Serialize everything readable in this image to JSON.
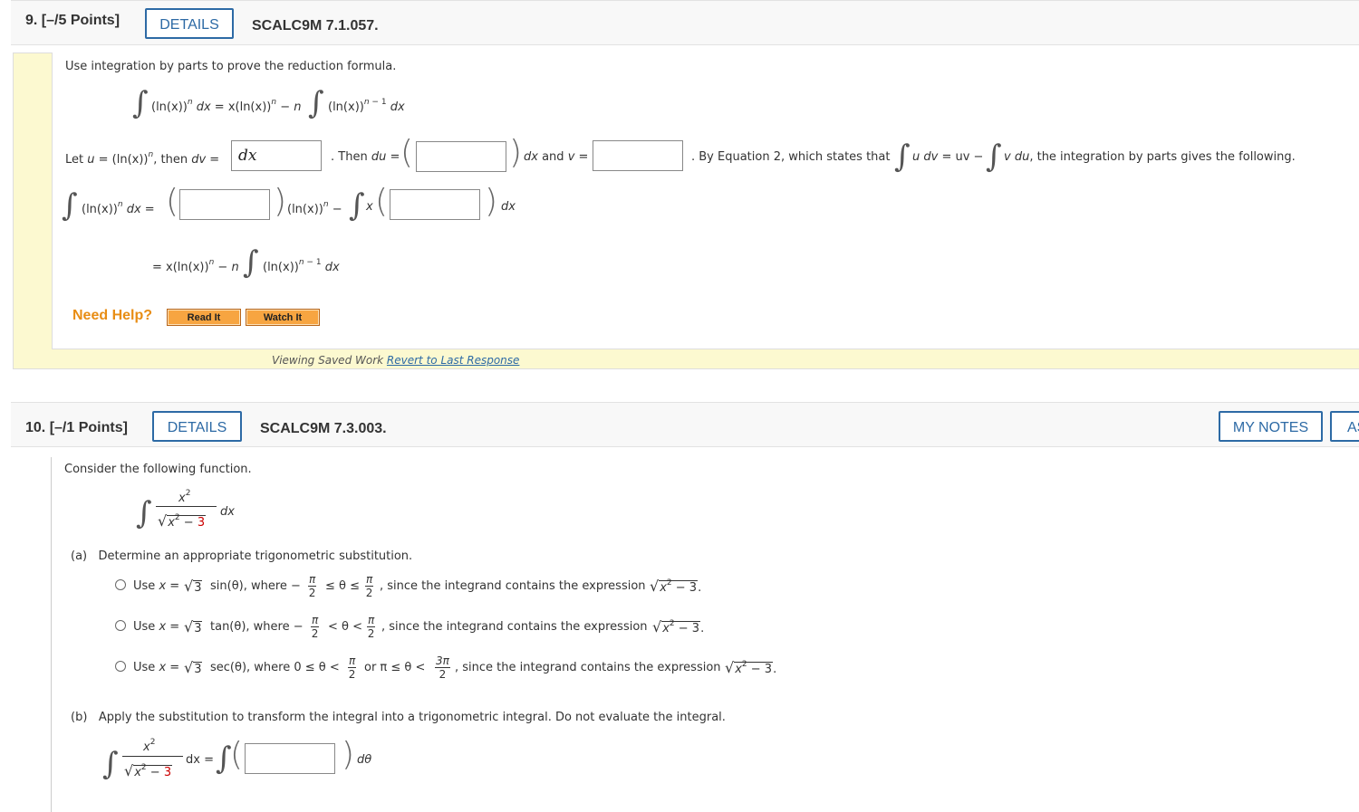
{
  "q9": {
    "number": "9.",
    "points": "[–/5 Points]",
    "details_label": "DETAILS",
    "code": "SCALC9M 7.1.057.",
    "instruction": "Use integration by parts to prove the reduction formula.",
    "formula_lhs": "(ln(x))",
    "formula_n": "n",
    "formula_dx": "dx = x(ln(x))",
    "formula_minus_n": "n",
    "formula_rhs": "(ln(x))",
    "formula_exp": "n − 1",
    "formula_end": "dx",
    "let_u_text_a": "Let",
    "let_u_var": "u",
    "let_u_text_b": "= (ln(x))",
    "let_u_text_c": ", then",
    "let_u_dv": "dv",
    "let_u_eq": "=",
    "dv_value": "dx",
    "then_du": ". Then",
    "du_var": "du",
    "du_eq": "=",
    "du_value": "",
    "dx_and_v": "dx and",
    "v_var": "v",
    "v_eq": "=",
    "v_value": "",
    "by_eq2": ". By Equation 2, which states that",
    "eq2_udv": "u dv",
    "eq2_uv": "= uv −",
    "eq2_vdu": "v du",
    "eq2_rest": ", the integration by parts gives the following.",
    "line2_lhs": "(ln(x))",
    "line2_n": "n",
    "line2_dx": "dx",
    "line2_eq": "=",
    "box1_value": "",
    "line2_mid": "(ln(x))",
    "line2_mid_n": "n",
    "line2_minus": "−",
    "line2_x": "x",
    "box2_value": "",
    "line2_dx2": "dx",
    "line3_eq": "= x(ln(x))",
    "line3_n": "n",
    "line3_minus_n": "−",
    "line3_nn": "n",
    "line3_rhs": "(ln(x))",
    "line3_exp": "n − 1",
    "line3_dx": "dx",
    "need_help": "Need Help?",
    "read_it": "Read It",
    "watch_it": "Watch It",
    "viewing_saved": "Viewing Saved Work",
    "revert_link": "Revert to Last Response"
  },
  "q10": {
    "number": "10.",
    "points": "[–/1 Points]",
    "details_label": "DETAILS",
    "code": "SCALC9M 7.3.003.",
    "my_notes": "MY NOTES",
    "ask_partial": "AS",
    "instruction": "Consider the following function.",
    "integrand_num": "x",
    "integrand_num_exp": "2",
    "integrand_den_x": "x",
    "integrand_den_exp": "2",
    "integrand_den_rest": "− ",
    "integrand_den_three": "3",
    "integrand_dx": "dx",
    "part_a_label": "(a)",
    "part_a_text": "Determine an appropriate trigonometric substitution.",
    "options": [
      {
        "pre": "Use",
        "x": "x",
        "eq": "=",
        "sqrt3": "3",
        "fn": "sin(θ), where −",
        "f1n": "π",
        "f1d": "2",
        "mid": "≤ θ ≤",
        "f2n": "π",
        "f2d": "2",
        "tail": ", since the integrand contains the expression",
        "expr": "x² − 3",
        "end": "."
      },
      {
        "pre": "Use",
        "x": "x",
        "eq": "=",
        "sqrt3": "3",
        "fn": "tan(θ), where −",
        "f1n": "π",
        "f1d": "2",
        "mid": "< θ <",
        "f2n": "π",
        "f2d": "2",
        "tail": ", since the integrand contains the expression",
        "expr": "x² − 3",
        "end": "."
      },
      {
        "pre": "Use",
        "x": "x",
        "eq": "=",
        "sqrt3": "3",
        "fn": "sec(θ), where 0 ≤ θ <",
        "f1n": "π",
        "f1d": "2",
        "mid": "or π ≤ θ <",
        "f2n": "3π",
        "f2d": "2",
        "tail": ", since the integrand contains the expression",
        "expr": "x² − 3",
        "end": "."
      }
    ],
    "part_b_label": "(b)",
    "part_b_text": "Apply the substitution to transform the integral into a trigonometric integral. Do not evaluate the integral.",
    "b_num": "x",
    "b_num_exp": "2",
    "b_den_x": "x",
    "b_den_exp": "2",
    "b_den_rest": "− ",
    "b_den_three": "3",
    "b_dx": "dx =",
    "b_box_value": "",
    "b_dtheta": "dθ"
  }
}
